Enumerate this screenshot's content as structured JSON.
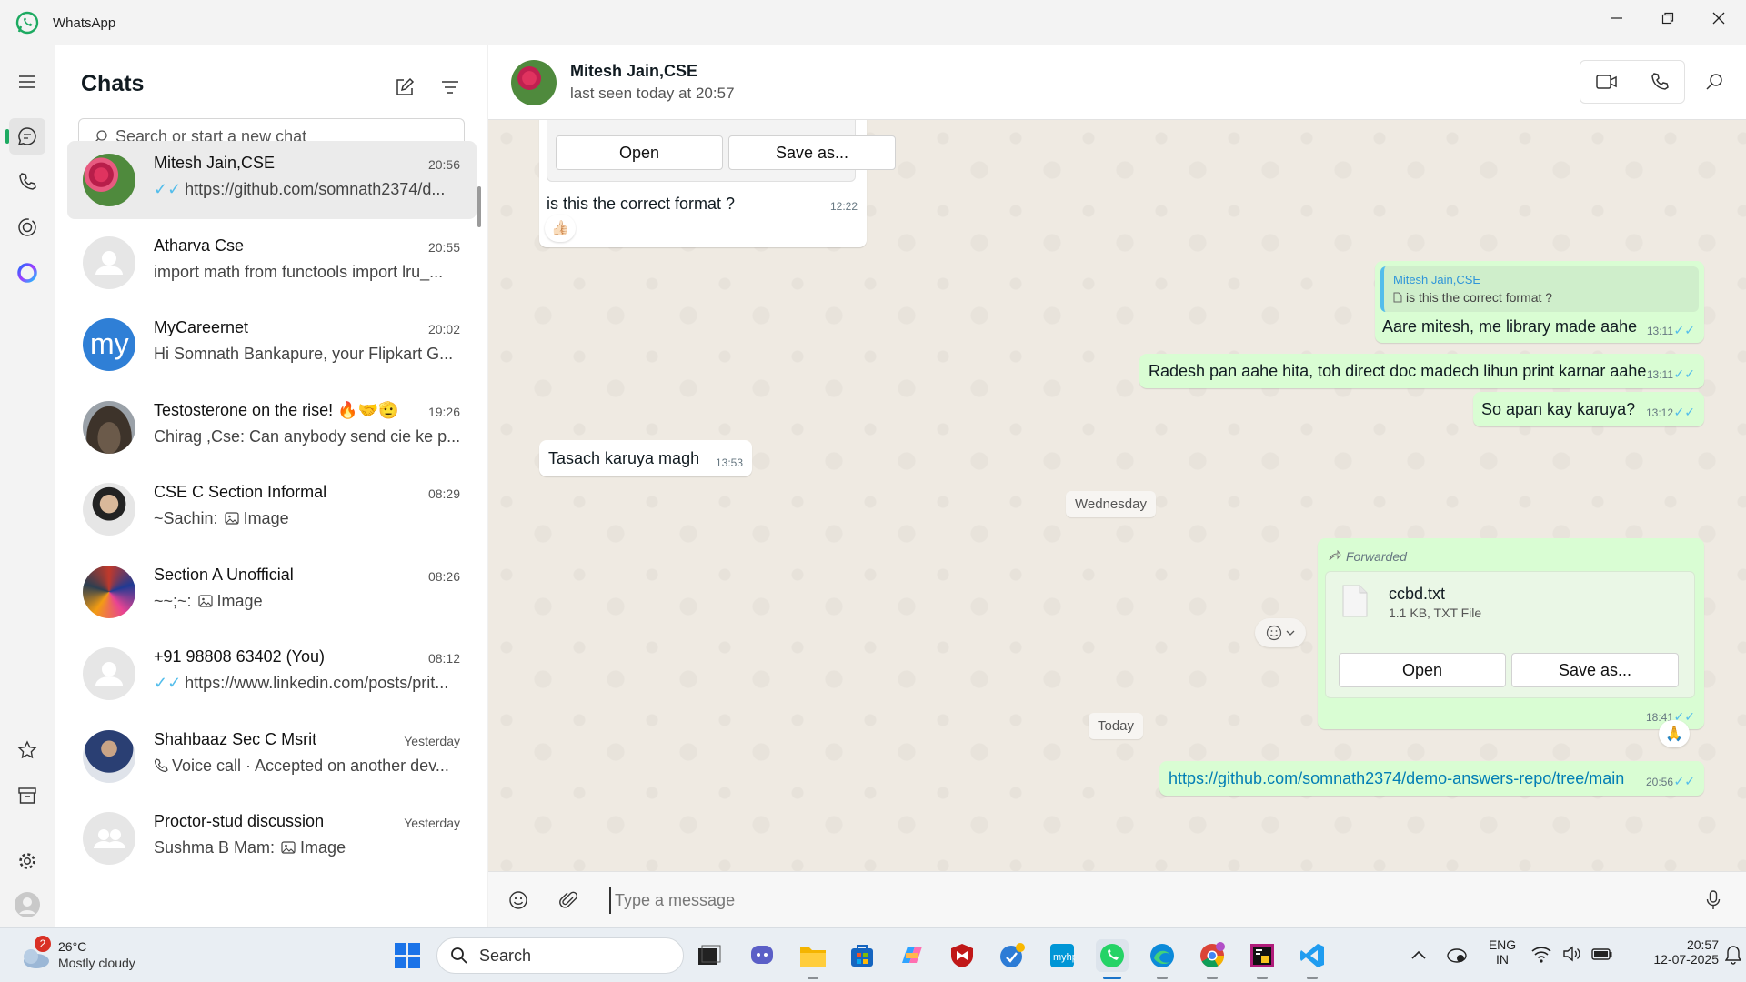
{
  "window": {
    "title": "WhatsApp",
    "accent": "#1daa61",
    "bubble_out": "#d9fdd3",
    "tick_color": "#53bdeb"
  },
  "chatlist": {
    "title": "Chats",
    "search_placeholder": "Search or start a new chat",
    "items": [
      {
        "name": "Mitesh Jain,CSE",
        "time": "20:56",
        "preview": "https://github.com/somnath2374/d...",
        "ticks": "✓✓",
        "avatar": "flower-photo"
      },
      {
        "name": "Atharva Cse",
        "time": "20:55",
        "preview": "import math from functools import lru_...",
        "avatar": "default-person"
      },
      {
        "name": "MyCareernet",
        "time": "20:02",
        "preview": "Hi Somnath Bankapure, your Flipkart G...",
        "avatar": "my-logo",
        "avatar_text": "my"
      },
      {
        "name": "Testosterone on the rise! 🔥🤝🫡",
        "time": "19:26",
        "preview": "Chirag ,Cse: Can anybody send cie ke p...",
        "avatar": "group-photo"
      },
      {
        "name": "CSE C Section Informal",
        "time": "08:29",
        "preview": "~Sachin: ",
        "preview_suffix": "Image",
        "avatar": "person-photo"
      },
      {
        "name": "Section A Unofficial",
        "time": "08:26",
        "preview": "~~;~: ",
        "preview_suffix": "Image",
        "avatar": "crowd-photo"
      },
      {
        "name": "+91 98808 63402 (You)",
        "time": "08:12",
        "preview": "https://www.linkedin.com/posts/prit...",
        "ticks": "✓✓",
        "avatar": "default-person"
      },
      {
        "name": "Shahbaaz Sec C Msrit",
        "time": "Yesterday",
        "preview": "Voice call · Accepted on another dev...",
        "avatar": "person-photo-2"
      },
      {
        "name": "Proctor-stud discussion",
        "time": "Yesterday",
        "preview": "Sushma B Mam: ",
        "preview_suffix": "Image",
        "avatar": "default-group"
      }
    ]
  },
  "conversation": {
    "contact_name": "Mitesh Jain,CSE",
    "status": "last seen today at 20:57",
    "messages": {
      "file_open_1": "Open",
      "file_save_1": "Save as...",
      "m1_text": "is this the correct format ?",
      "m1_time": "12:22",
      "m1_reaction": "👍🏻",
      "m2_quote_author": "Mitesh Jain,CSE",
      "m2_quote_text": "is this the correct format ?",
      "m2_text": "Aare mitesh, me library made aahe",
      "m2_time": "13:11",
      "m3_text": "Radesh pan aahe hita, toh direct doc madech lihun print karnar aahe",
      "m3_time": "13:11",
      "m4_text": "So apan kay karuya?",
      "m4_time": "13:12",
      "m5_text": "Tasach karuya magh",
      "m5_time": "13:53",
      "date_1": "Wednesday",
      "fwd_label": "Forwarded",
      "file_name": "ccbd.txt",
      "file_meta": "1.1 KB, TXT File",
      "file_open_2": "Open",
      "file_save_2": "Save as...",
      "m6_time": "18:41",
      "m6_reaction": "🙏",
      "date_2": "Today",
      "m7_text": "https://github.com/somnath2374/demo-answers-repo/tree/main",
      "m7_time": "20:56",
      "ticks": "✓✓"
    },
    "composer_placeholder": "Type a message"
  },
  "taskbar": {
    "weather_temp": "26°C",
    "weather_desc": "Mostly cloudy",
    "weather_badge": "2",
    "search_label": "Search",
    "lang_1": "ENG",
    "lang_2": "IN",
    "time": "20:57",
    "date": "12-07-2025"
  }
}
